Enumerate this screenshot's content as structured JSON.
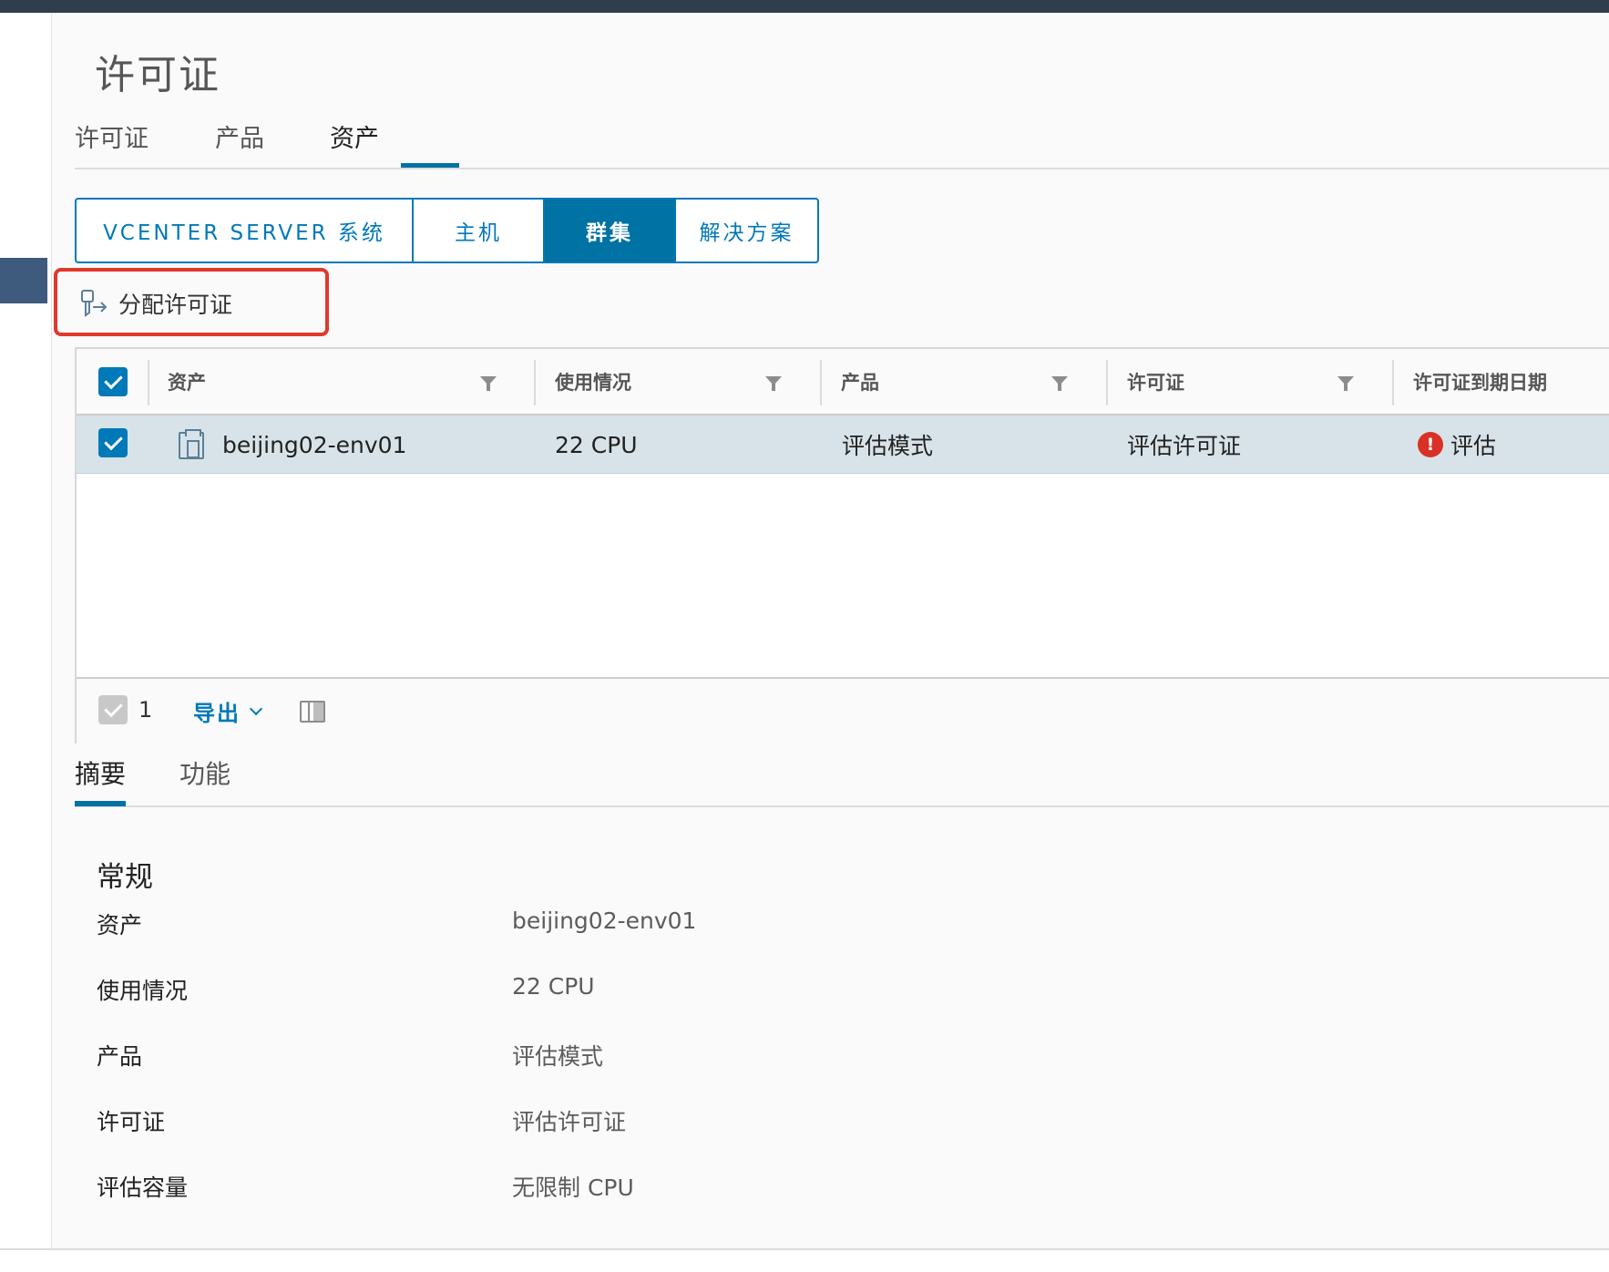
{
  "page": {
    "title": "许可证"
  },
  "tabs": [
    {
      "label": "许可证"
    },
    {
      "label": "产品"
    },
    {
      "label": "资产"
    }
  ],
  "segments": [
    {
      "label": "VCENTER SERVER 系统"
    },
    {
      "label": "主机"
    },
    {
      "label": "群集"
    },
    {
      "label": "解决方案"
    }
  ],
  "active_segment": "群集",
  "toolbar": {
    "assign_label": "分配许可证"
  },
  "grid": {
    "columns": [
      "资产",
      "使用情况",
      "产品",
      "许可证",
      "许可证到期日期"
    ],
    "rows": [
      {
        "asset": "beijing02-env01",
        "usage": "22 CPU",
        "product": "评估模式",
        "license": "评估许可证",
        "expiry": "评估"
      }
    ],
    "footer": {
      "selected_count": "1",
      "export_label": "导出"
    }
  },
  "detail_tabs": [
    {
      "label": "摘要"
    },
    {
      "label": "功能"
    }
  ],
  "summary": {
    "section_title": "常规",
    "items": [
      {
        "key": "资产",
        "value": "beijing02-env01"
      },
      {
        "key": "使用情况",
        "value": "22 CPU"
      },
      {
        "key": "产品",
        "value": "评估模式"
      },
      {
        "key": "许可证",
        "value": "评估许可证"
      },
      {
        "key": "评估容量",
        "value": "无限制 CPU"
      }
    ]
  },
  "colors": {
    "accent": "#0072a3",
    "highlight_box": "#e0382b",
    "selected_row": "#d8e3e9",
    "alert": "#d93125"
  }
}
